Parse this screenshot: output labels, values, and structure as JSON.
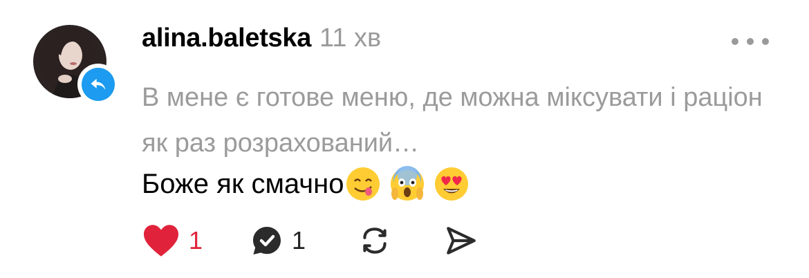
{
  "comment": {
    "username": "alina.baletska",
    "time": "11 хв",
    "quoted_text": "В мене є готове меню, де можна міксувати і раціон як раз розрахований…",
    "text": "Боже як смачно",
    "emojis": [
      "yum-emoji",
      "scream-emoji",
      "heart-eyes-emoji"
    ]
  },
  "actions": {
    "likes": "1",
    "replies": "1"
  },
  "colors": {
    "like": "#e0233a",
    "reply_badge": "#1c9bf0",
    "muted": "#9b9b9b"
  },
  "icons": {
    "more": "more-dots-icon",
    "like": "heart-icon",
    "reply": "reply-bubble-icon",
    "repost": "repost-icon",
    "share": "send-icon",
    "badge": "reply-arrow-icon"
  }
}
